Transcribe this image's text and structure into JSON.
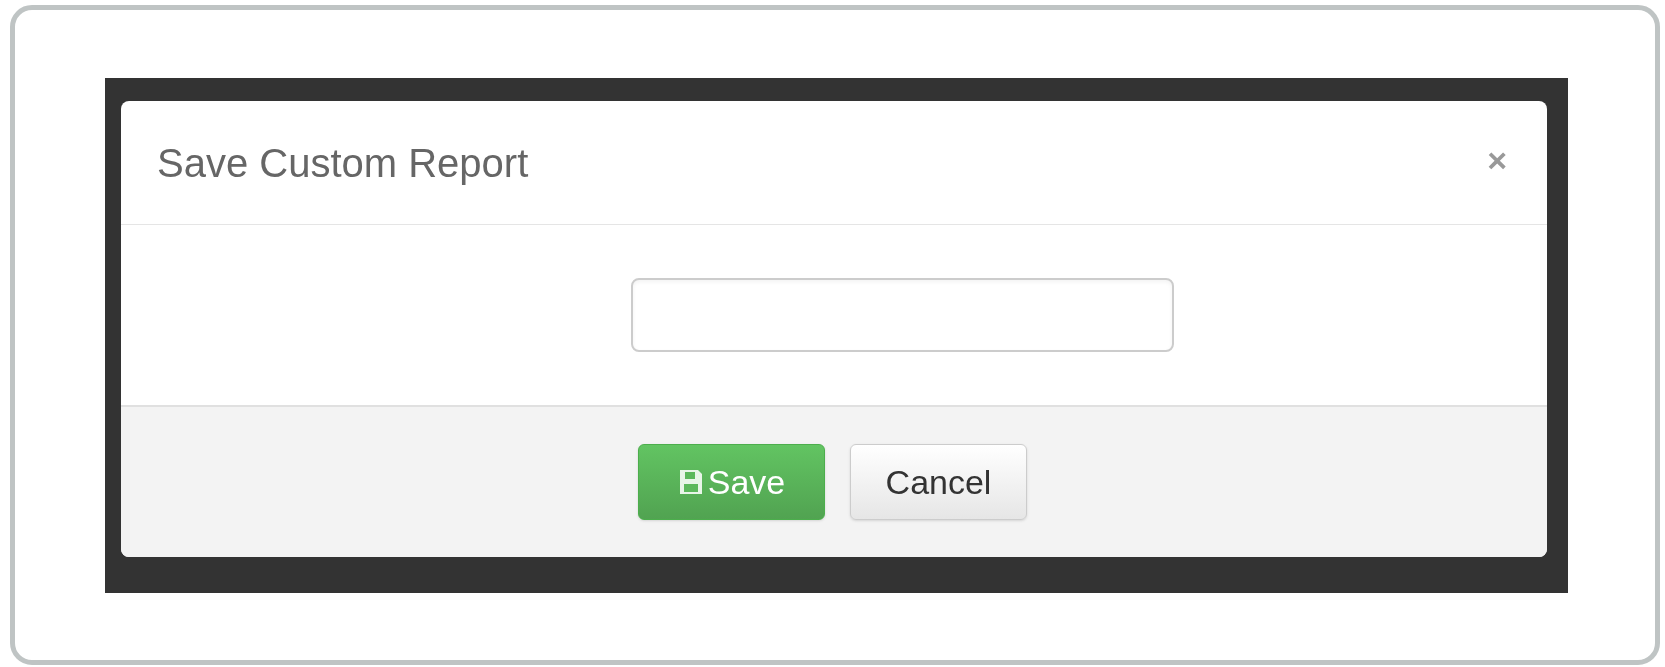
{
  "dialog": {
    "title": "Save Custom Report",
    "close": "×"
  },
  "buttons": [
    {
      "label": "Save",
      "kind": "primary"
    },
    {
      "label": "Cancel",
      "kind": "default"
    }
  ]
}
